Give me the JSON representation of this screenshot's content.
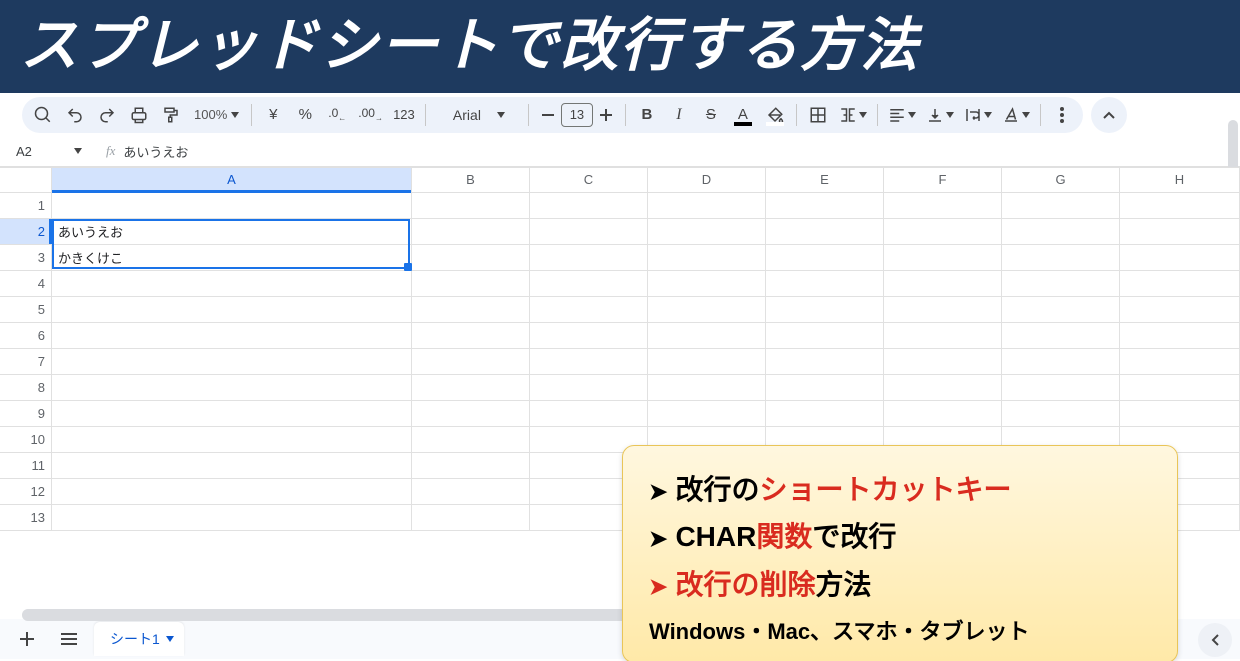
{
  "banner": {
    "title": "スプレッドシートで改行する方法"
  },
  "toolbar": {
    "zoom": "100%",
    "font_name": "Arial",
    "font_size": "13"
  },
  "name_box": "A2",
  "formula_bar": "あいうえお",
  "columns": [
    "A",
    "B",
    "C",
    "D",
    "E",
    "F",
    "G",
    "H"
  ],
  "rows": [
    "1",
    "2",
    "3",
    "4",
    "5",
    "6",
    "7",
    "8",
    "9",
    "10",
    "11",
    "12",
    "13"
  ],
  "active_cell": {
    "row_index": 1,
    "col_index": 0
  },
  "cells": {
    "A2": "あいうえお",
    "A3": "かきくけこ"
  },
  "overlay": {
    "line1_pre": "改行の",
    "line1_red": "ショートカットキー",
    "line2_pre": "CHAR",
    "line2_red": "関数",
    "line2_post": "で改行",
    "line3_red": "改行の削除",
    "line3_post": "方法",
    "sub": "Windows・Mac、スマホ・タブレット"
  },
  "sheet_tab": "シート1"
}
